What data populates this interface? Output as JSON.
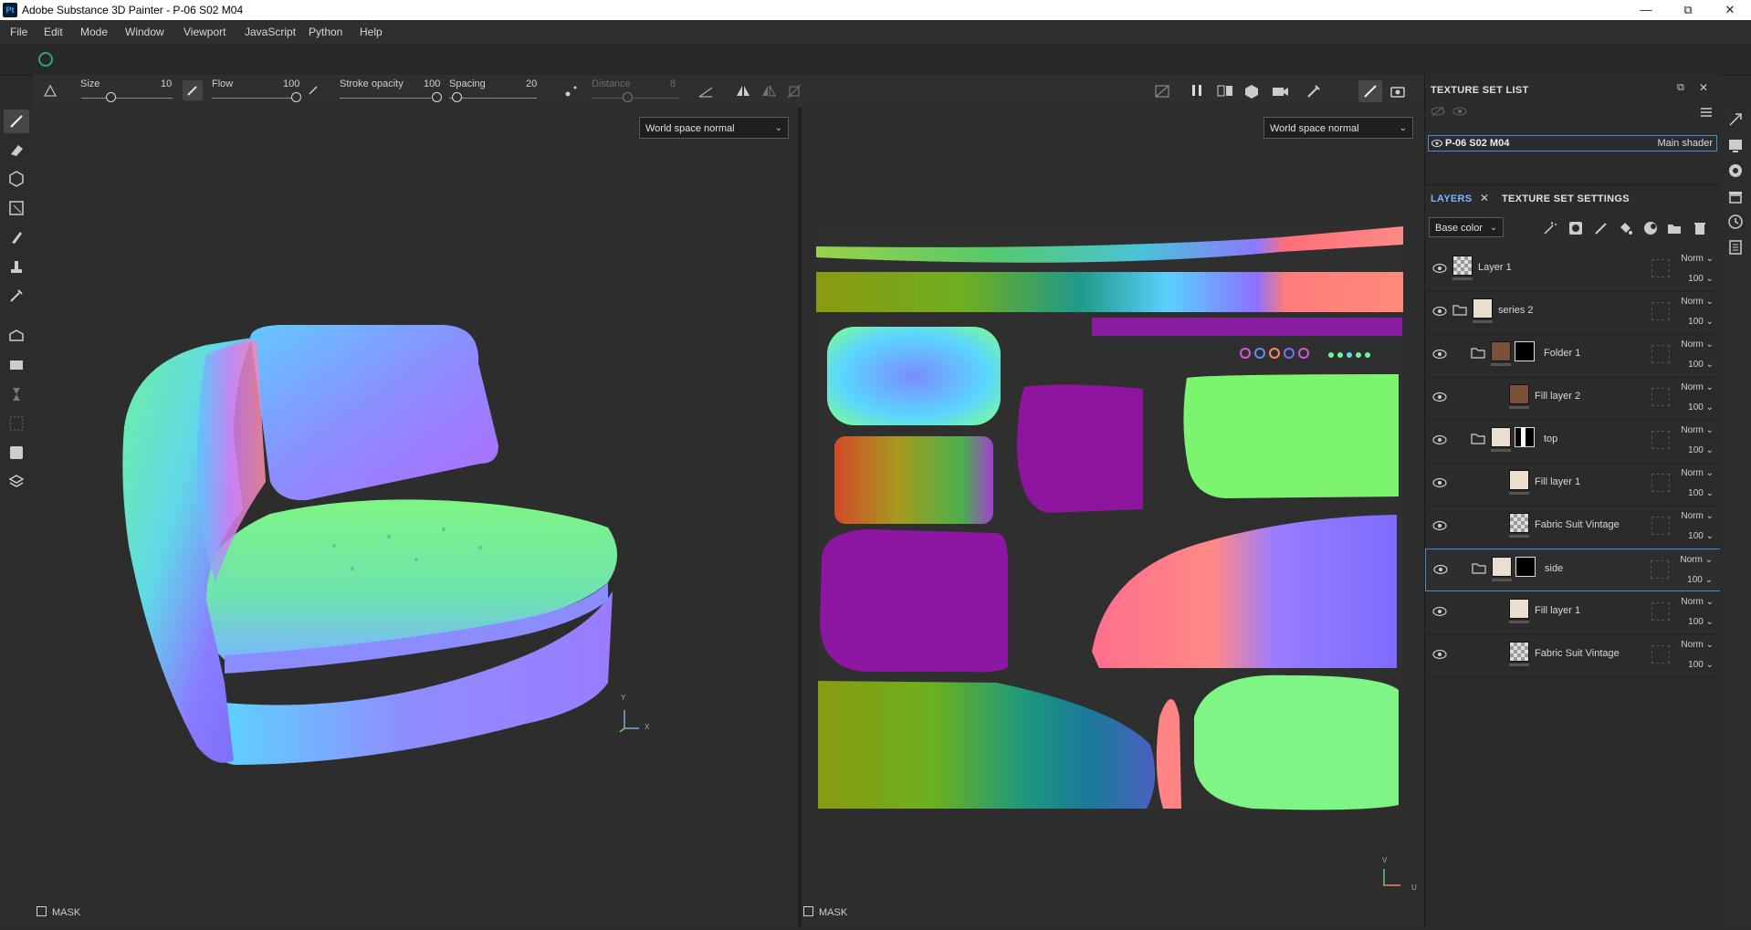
{
  "window": {
    "title": "Adobe Substance 3D Painter - P-06 S02 M04",
    "logo": "Pt"
  },
  "menu": [
    "File",
    "Edit",
    "Mode",
    "Window",
    "Viewport",
    "JavaScript",
    "Python",
    "Help"
  ],
  "brush": {
    "size_label": "Size",
    "size_value": "10",
    "flow_label": "Flow",
    "flow_value": "100",
    "stroke_opacity_label": "Stroke opacity",
    "stroke_opacity_value": "100",
    "spacing_label": "Spacing",
    "spacing_value": "20",
    "distance_label": "Distance",
    "distance_value": "8"
  },
  "viewport3d": {
    "mode": "World space normal",
    "mask_label": "MASK",
    "axis_y": "Y",
    "axis_x": "X"
  },
  "viewport2d": {
    "mode": "World space normal",
    "mask_label": "MASK",
    "axis_v": "V",
    "axis_u": "U"
  },
  "texture_set_list": {
    "title": "TEXTURE SET LIST",
    "set_name": "P-06 S02 M04",
    "shader": "Main shader"
  },
  "layers_panel": {
    "tab_layers": "LAYERS",
    "tab_settings": "TEXTURE SET SETTINGS",
    "channel": "Base color",
    "layers": [
      {
        "name": "Layer 1",
        "blend": "Norm",
        "opacity": "100",
        "thumb": "checker",
        "folder": false,
        "indent": 0,
        "mask": "none",
        "selected": false
      },
      {
        "name": "series 2",
        "blend": "Norm",
        "opacity": "100",
        "thumb": "#e9dfcf",
        "folder": true,
        "indent": 0,
        "mask": "none",
        "selected": false
      },
      {
        "name": "Folder 1",
        "blend": "Norm",
        "opacity": "100",
        "thumb": "#7a4f3c",
        "folder": true,
        "indent": 1,
        "mask": "black",
        "selected": false
      },
      {
        "name": "Fill layer 2",
        "blend": "Norm",
        "opacity": "100",
        "thumb": "#7a4f3c",
        "folder": false,
        "indent": 2,
        "mask": "none",
        "selected": false
      },
      {
        "name": "top",
        "blend": "Norm",
        "opacity": "100",
        "thumb": "#e9dfcf",
        "folder": true,
        "indent": 1,
        "mask": "pattern",
        "selected": false
      },
      {
        "name": "Fill layer 1",
        "blend": "Norm",
        "opacity": "100",
        "thumb": "#e9dfcf",
        "folder": false,
        "indent": 2,
        "mask": "none",
        "selected": false
      },
      {
        "name": "Fabric Suit Vintage",
        "blend": "Norm",
        "opacity": "100",
        "thumb": "checker",
        "folder": false,
        "indent": 2,
        "mask": "none",
        "selected": false
      },
      {
        "name": "side",
        "blend": "Norm",
        "opacity": "100",
        "thumb": "#e9dfcf",
        "folder": true,
        "indent": 1,
        "mask": "black",
        "selected": true
      },
      {
        "name": "Fill layer 1",
        "blend": "Norm",
        "opacity": "100",
        "thumb": "#e9dfcf",
        "folder": false,
        "indent": 2,
        "mask": "none",
        "selected": false
      },
      {
        "name": "Fabric Suit Vintage",
        "blend": "Norm",
        "opacity": "100",
        "thumb": "checker",
        "folder": false,
        "indent": 2,
        "mask": "none",
        "selected": false
      }
    ]
  }
}
